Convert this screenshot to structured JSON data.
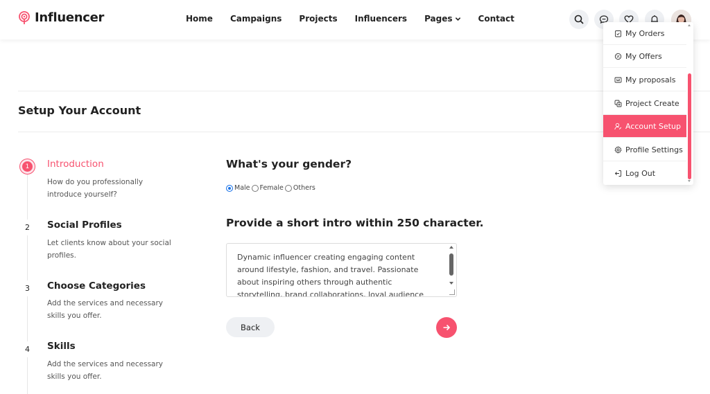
{
  "brand": {
    "name": "Influencer",
    "accent": "#f7526f"
  },
  "nav": {
    "items": [
      "Home",
      "Campaigns",
      "Projects",
      "Influencers",
      "Pages",
      "Contact"
    ]
  },
  "header_actions": [
    "search-icon",
    "chat-icon",
    "heart-icon",
    "bell-icon",
    "avatar"
  ],
  "page": {
    "title": "Setup Your Account"
  },
  "steps": [
    {
      "number": "1",
      "title": "Introduction",
      "desc": "How do you professionally introduce yourself?"
    },
    {
      "number": "2",
      "title": "Social Profiles",
      "desc": "Let clients know about your social profiles."
    },
    {
      "number": "3",
      "title": "Choose Categories",
      "desc": "Add the services and necessary skills you offer."
    },
    {
      "number": "4",
      "title": "Skills",
      "desc": "Add the services and necessary skills you offer."
    }
  ],
  "form": {
    "gender_question": "What's your gender?",
    "gender_options": [
      "Male",
      "Female",
      "Others"
    ],
    "gender_selected": "Male",
    "intro_question": "Provide a short intro within 250 character.",
    "intro_value": " Dynamic influencer creating engaging content around lifestyle, fashion, and travel. Passionate about inspiring others through authentic storytelling, brand collaborations, loyal audience across multiple platforms.",
    "back_label": "Back"
  },
  "dropdown": {
    "items": [
      "My Orders",
      "My Offers",
      "My proposals",
      "Project Create",
      "Account Setup",
      "Profile Settings",
      "Log Out"
    ],
    "icons": [
      "orders-icon",
      "offers-icon",
      "proposals-icon",
      "project-create-icon",
      "user-setup-icon",
      "settings-icon",
      "logout-icon"
    ],
    "active": "Account Setup"
  }
}
